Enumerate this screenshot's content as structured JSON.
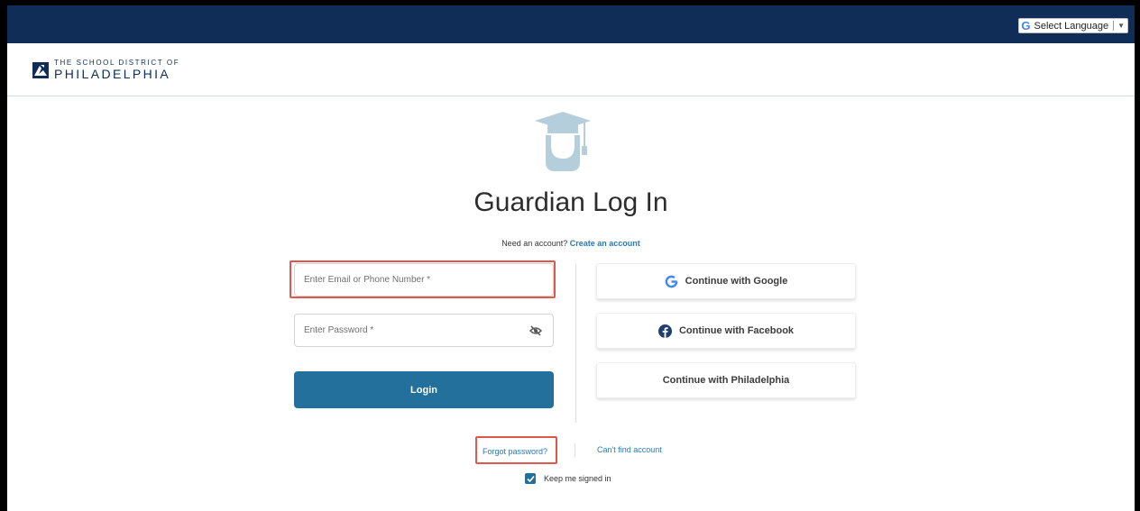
{
  "topbar": {
    "language_select": {
      "icon": "google-g-icon",
      "label": "Select Language",
      "arrow": "▼"
    }
  },
  "header": {
    "logo_line1": "THE SCHOOL DISTRICT OF",
    "logo_line2": "PHILADELPHIA",
    "logo_icon": "district-logo-icon"
  },
  "main": {
    "hero_icon": "graduate-cap-icon",
    "title": "Guardian Log In",
    "need_account_text": "Need an account?",
    "create_account_link": "Create an account",
    "email_placeholder": "Enter Email or Phone Number *",
    "password_placeholder": "Enter Password *",
    "password_toggle_icon": "eye-slash-icon",
    "login_label": "Login",
    "sso_buttons": [
      {
        "label": "Continue with Google",
        "icon": "google-g-icon"
      },
      {
        "label": "Continue with Facebook",
        "icon": "facebook-f-icon"
      },
      {
        "label": "Continue with Philadelphia",
        "icon": ""
      }
    ],
    "forgot_password": "Forgot password?",
    "cant_find_account": "Can't find account",
    "keep_signed_in": "Keep me signed in",
    "keep_signed_in_checked": true
  },
  "colors": {
    "topbar": "#0f2d57",
    "primary_button": "#23709c",
    "link": "#2b78b4",
    "highlight": "#e0574c",
    "hero_icon": "#b4cedb"
  }
}
